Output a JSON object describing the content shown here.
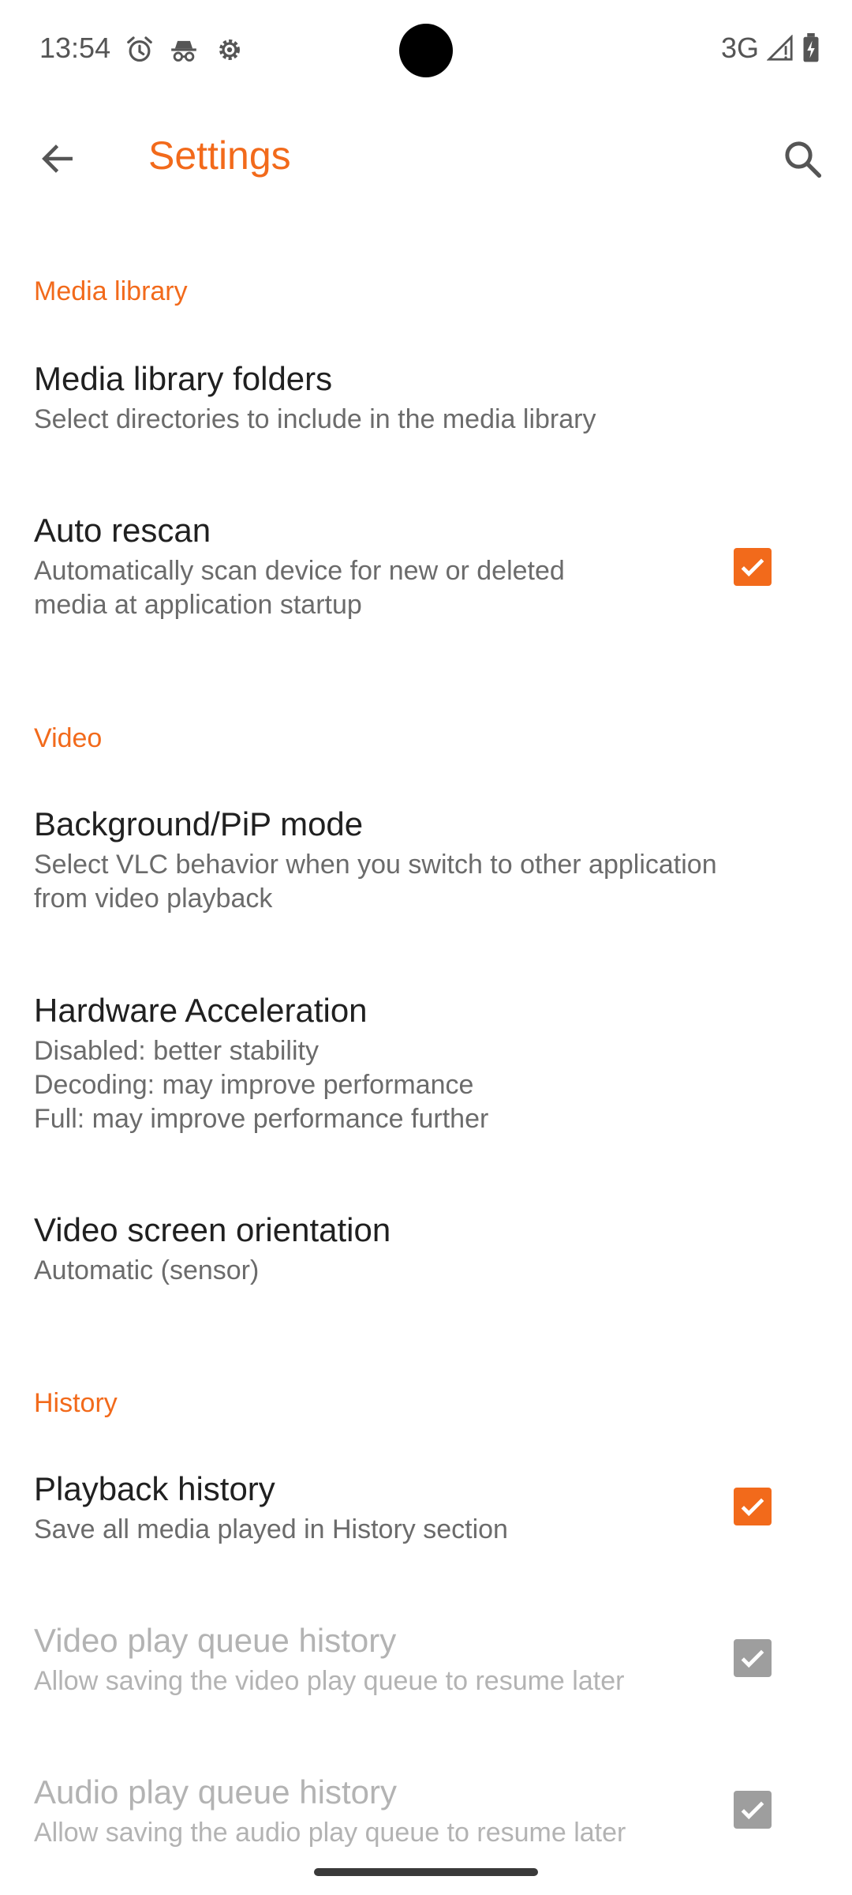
{
  "status_bar": {
    "time": "13:54",
    "icons_left": [
      "alarm-icon",
      "incognito-icon",
      "settings-gear-icon"
    ],
    "network": "3G",
    "icons_right": [
      "signal-icon",
      "battery-charging-icon"
    ]
  },
  "toolbar": {
    "back_icon": "arrow-back-icon",
    "title": "Settings",
    "search_icon": "search-icon"
  },
  "colors": {
    "accent": "#f26a1b",
    "title_text": "#202020",
    "summary_text": "#6b6b6b",
    "disabled_text": "#b3b3b3",
    "disabled_checkbox": "#9e9e9e"
  },
  "sections": {
    "media_library": {
      "header": "Media library",
      "folders": {
        "title": "Media library folders",
        "summary": "Select directories to include in the media library"
      },
      "auto_rescan": {
        "title": "Auto rescan",
        "summary": "Automatically scan device for new or deleted\nmedia at application startup",
        "checked": true,
        "enabled": true
      }
    },
    "video": {
      "header": "Video",
      "background_pip": {
        "title": "Background/PiP mode",
        "summary": "Select VLC behavior when you switch to other application\nfrom video playback"
      },
      "hw_accel": {
        "title": "Hardware Acceleration",
        "summary": "Disabled: better stability\nDecoding: may improve performance\nFull: may improve performance further"
      },
      "orientation": {
        "title": "Video screen orientation",
        "summary": "Automatic (sensor)"
      }
    },
    "history": {
      "header": "History",
      "playback_history": {
        "title": "Playback history",
        "summary": "Save all media played in History section",
        "checked": true,
        "enabled": true
      },
      "video_queue": {
        "title": "Video play queue history",
        "summary": "Allow saving the video play queue to resume later",
        "checked": true,
        "enabled": false
      },
      "audio_queue": {
        "title": "Audio play queue history",
        "summary": "Allow saving the audio play queue to resume later",
        "checked": true,
        "enabled": false
      }
    }
  }
}
